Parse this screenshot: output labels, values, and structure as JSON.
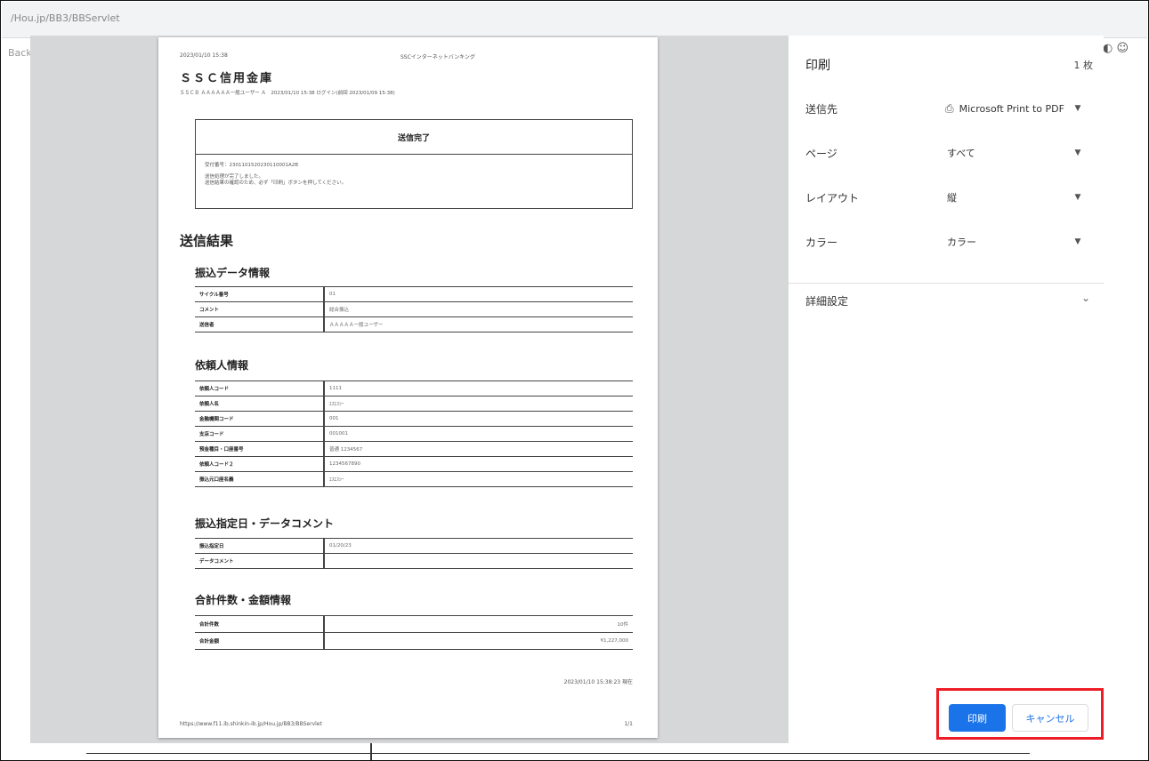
{
  "browser": {
    "url": "/Hou.jp/BB3/BBServlet",
    "bg_left_text": "Back",
    "bg_right_text": "◐ ☺"
  },
  "preview": {
    "page_header_date": "2023/01/10 15:38",
    "page_header_title": "SSCインターネットバンキング",
    "bank_name": "ＳＳＣ信用金庫",
    "sub_line": "ＳＳＣＢ ＡＡＡＡＡＡ一般ユーザー Ａ　2023/01/10 15:38 ログイン(前回 2023/01/09 15:38)",
    "done_title": "送信完了",
    "done_line1": "受付番号：2301101520230110001A2B",
    "done_line2": "送信処理が完了しました。",
    "done_line3": "送信結果の確認のため、必ず「印刷」ボタンを押してください。",
    "results_heading": "送信結果",
    "section1_title": "振込データ情報",
    "section1_rows": [
      {
        "k": "サイクル番号",
        "v": "01"
      },
      {
        "k": "コメント",
        "v": "総合振込"
      },
      {
        "k": "送信者",
        "v": "ＡＡＡＡＡ一般ユーザー"
      }
    ],
    "section2_title": "依頼人情報",
    "section2_rows": [
      {
        "k": "依頼人コード",
        "v": "1111"
      },
      {
        "k": "依頼人名",
        "v": "ｴｽｴｽｼｰ"
      },
      {
        "k": "金融機関コード",
        "v": "001"
      },
      {
        "k": "支店コード",
        "v": "001001"
      },
      {
        "k": "預金種目・口座番号",
        "v": "普通 1234567"
      },
      {
        "k": "依頼人コード２",
        "v": "1234567890"
      },
      {
        "k": "振込元口座名義",
        "v": "ｴｽｴｽｼｰ"
      }
    ],
    "section3_title": "振込指定日・データコメント",
    "section3_rows": [
      {
        "k": "振込指定日",
        "v": "01/20/23"
      },
      {
        "k": "データコメント",
        "v": ""
      }
    ],
    "section4_title": "合計件数・金額情報",
    "section4_rows": [
      {
        "k": "合計件数",
        "v": "10件"
      },
      {
        "k": "合計金額",
        "v": "¥1,227,000"
      }
    ],
    "footer_timestamp": "2023/01/10 15:38:23 現在",
    "footer_url": "https://www.f11.ib.shinkin-ib.jp/Hou.jp/BB3/BBServlet",
    "footer_page": "1/1"
  },
  "panel": {
    "title": "印刷",
    "page_count": "1 枚",
    "destination_label": "送信先",
    "destination_value": "Microsoft Print to PDF",
    "destination_icon": "printer-icon",
    "pages_label": "ページ",
    "pages_value": "すべて",
    "layout_label": "レイアウト",
    "layout_value": "縦",
    "color_label": "カラー",
    "color_value": "カラー",
    "more_settings": "詳細設定",
    "print_button": "印刷",
    "cancel_button": "キャンセル",
    "accent_color": "#1a73e8",
    "highlight_color": "#ee1c25"
  }
}
